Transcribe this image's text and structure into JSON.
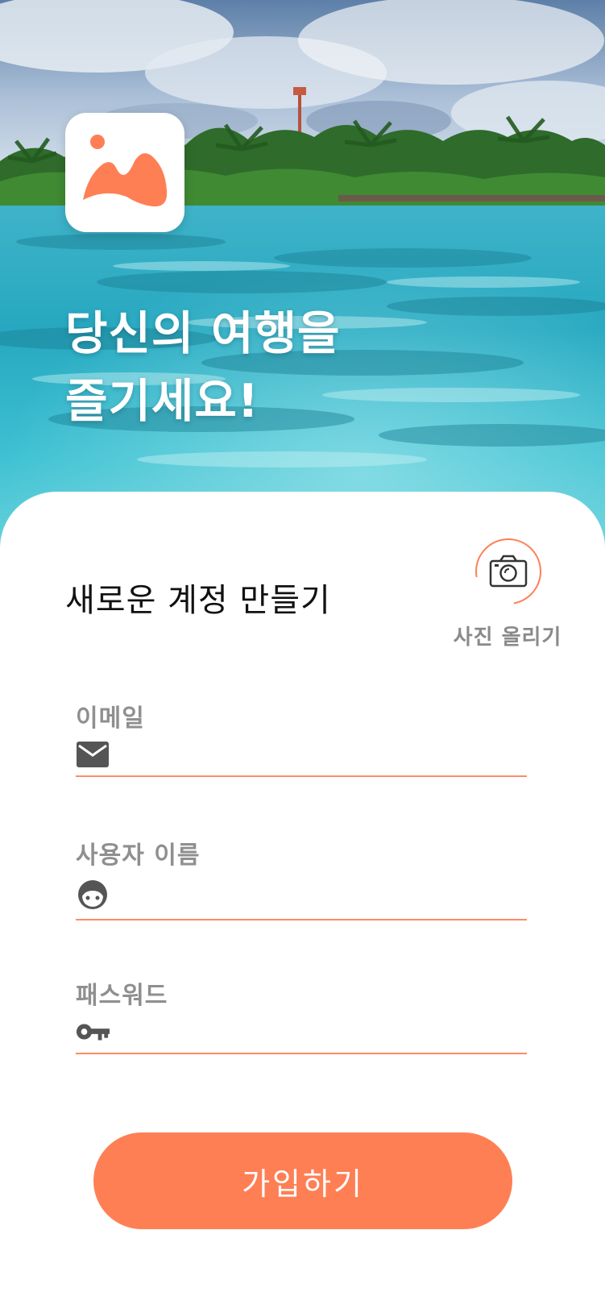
{
  "hero": {
    "title_line1": "당신의 여행을",
    "title_line2": "즐기세요!",
    "logo_icon": "mountain-sun-icon"
  },
  "form": {
    "title": "새로운 계정 만들기",
    "photo_upload_label": "사진 올리기",
    "photo_upload_icon": "camera-icon",
    "fields": [
      {
        "label": "이메일",
        "icon": "mail-icon",
        "value": "",
        "placeholder": ""
      },
      {
        "label": "사용자 이름",
        "icon": "face-icon",
        "value": "",
        "placeholder": ""
      },
      {
        "label": "패스워드",
        "icon": "key-icon",
        "value": "",
        "placeholder": ""
      }
    ],
    "submit_label": "가입하기"
  },
  "colors": {
    "accent": "#ff7f55",
    "label_gray": "#8f8f8f",
    "icon_gray": "#555555"
  }
}
